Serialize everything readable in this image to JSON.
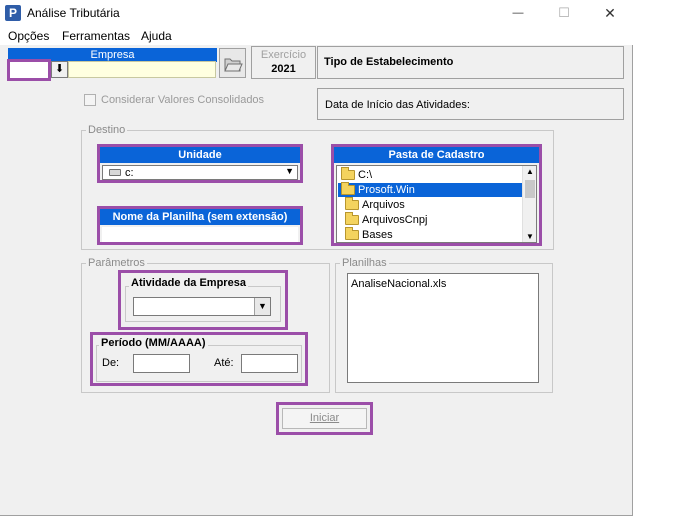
{
  "window": {
    "title": "Análise Tributária",
    "app_icon_letter": "P",
    "minimize_glyph": "—",
    "maximize_glyph": "☐",
    "close_glyph": "✕"
  },
  "menu": {
    "items": [
      "Opções",
      "Ferramentas",
      "Ajuda"
    ]
  },
  "empresa": {
    "label": "Empresa",
    "code_value": "",
    "name_value": "",
    "dropdown_glyph": "⬇"
  },
  "exercicio": {
    "label": "Exercício",
    "value": "2021"
  },
  "tipo_estabelecimento": {
    "label": "Tipo de Estabelecimento"
  },
  "consolidados": {
    "label": "Considerar Valores Consolidados",
    "checked": false
  },
  "data_inicio": {
    "label": "Data de Início das Atividades:"
  },
  "destino": {
    "legend": "Destino",
    "unidade_label": "Unidade",
    "unidade_value": "c:",
    "planilha_label": "Nome da Planilha (sem extensão)",
    "planilha_value": "",
    "pasta_label": "Pasta de Cadastro",
    "folders": [
      "C:\\",
      "Prosoft.Win",
      "Arquivos",
      "ArquivosCnpj",
      "Bases"
    ],
    "selected_folder": "Prosoft.Win"
  },
  "parametros": {
    "legend": "Parâmetros",
    "atividade_label": "Atividade da Empresa",
    "atividade_value": "",
    "periodo_label": "Período (MM/AAAA)",
    "de_label": "De:",
    "de_value": "",
    "ate_label": "Até:",
    "ate_value": ""
  },
  "planilhas": {
    "legend": "Planilhas",
    "items": [
      "AnaliseNacional.xls"
    ]
  },
  "actions": {
    "iniciar_label": "Iniciar"
  },
  "colors": {
    "accent": "#9b4ea8",
    "header_blue": "#0a64d8",
    "window_bg": "#f0f0f0"
  }
}
